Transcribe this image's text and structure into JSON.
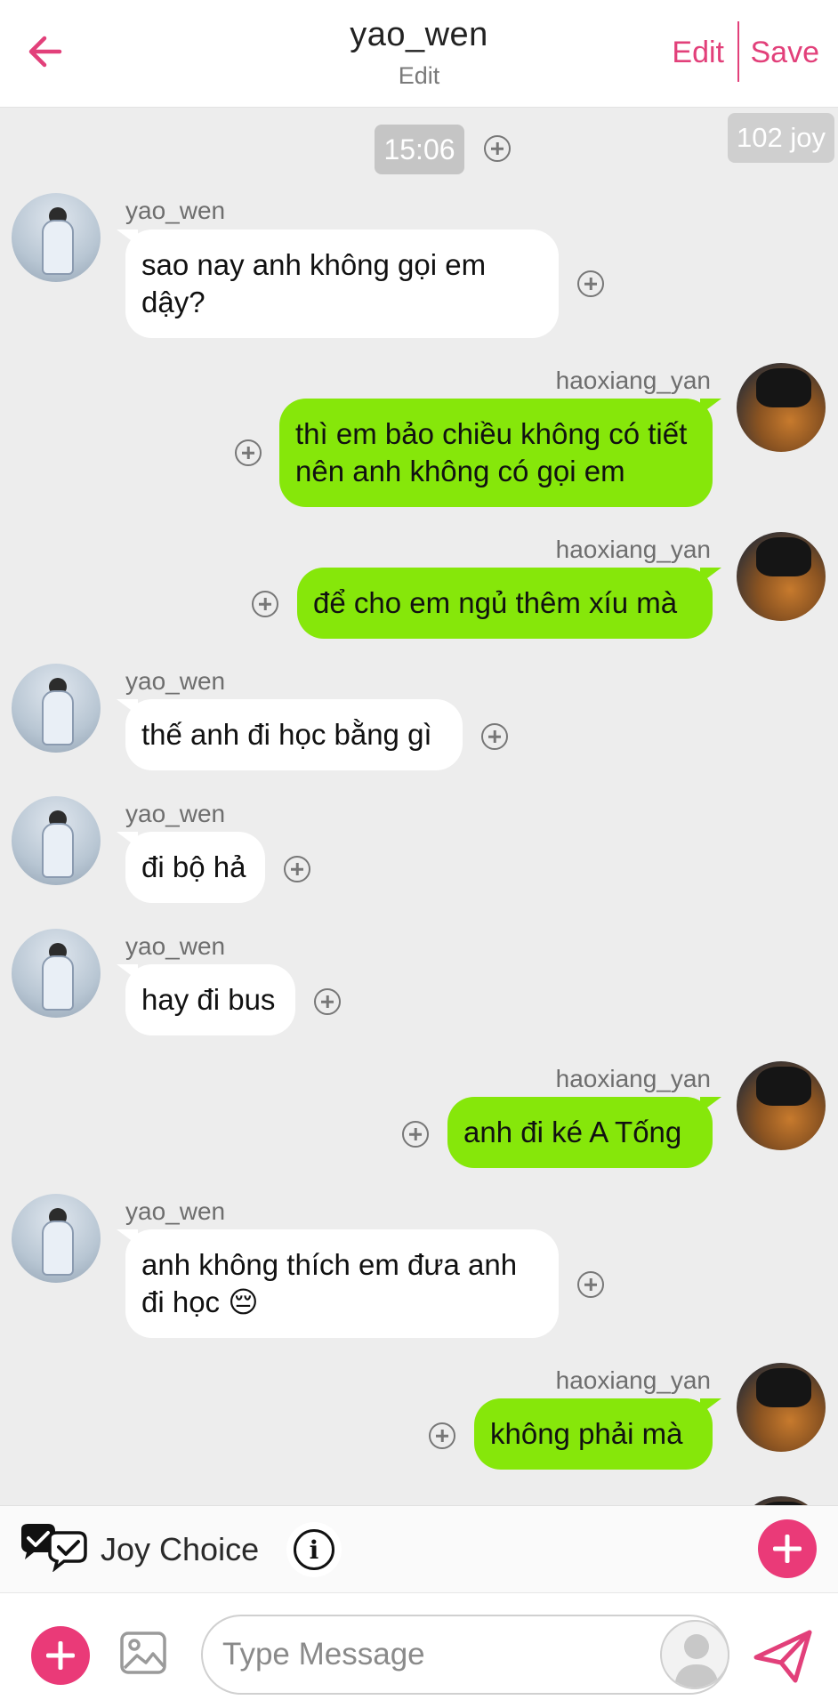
{
  "header": {
    "title": "yao_wen",
    "subtitle": "Edit",
    "edit_label": "Edit",
    "save_label": "Save"
  },
  "chat": {
    "time": "15:06",
    "joy": "102 joy",
    "messages": [
      {
        "from": "yao_wen",
        "side": "left",
        "text": "sao nay anh không gọi em dậy?"
      },
      {
        "from": "haoxiang_yan",
        "side": "right",
        "text": "thì em bảo chiều không có tiết nên anh không có gọi em"
      },
      {
        "from": "haoxiang_yan",
        "side": "right",
        "text": "để cho em ngủ thêm xíu mà"
      },
      {
        "from": "yao_wen",
        "side": "left",
        "text": "thế anh đi học bằng gì"
      },
      {
        "from": "yao_wen",
        "side": "left",
        "text": "đi bộ hả"
      },
      {
        "from": "yao_wen",
        "side": "left",
        "text": "hay đi bus"
      },
      {
        "from": "haoxiang_yan",
        "side": "right",
        "text": "anh đi ké A Tống"
      },
      {
        "from": "yao_wen",
        "side": "left",
        "text": "anh không thích em đưa anh đi học 😔"
      },
      {
        "from": "haoxiang_yan",
        "side": "right",
        "text": "không phải mà"
      }
    ]
  },
  "joy_bar": {
    "label": "Joy Choice",
    "info_icon": "info-icon",
    "accent": "#ea3a78"
  },
  "composer": {
    "placeholder": "Type Message",
    "value": ""
  },
  "colors": {
    "accent_pink": "#e2407a",
    "bubble_out": "#86e70a",
    "bubble_in": "#ffffff",
    "background": "#ededed"
  }
}
